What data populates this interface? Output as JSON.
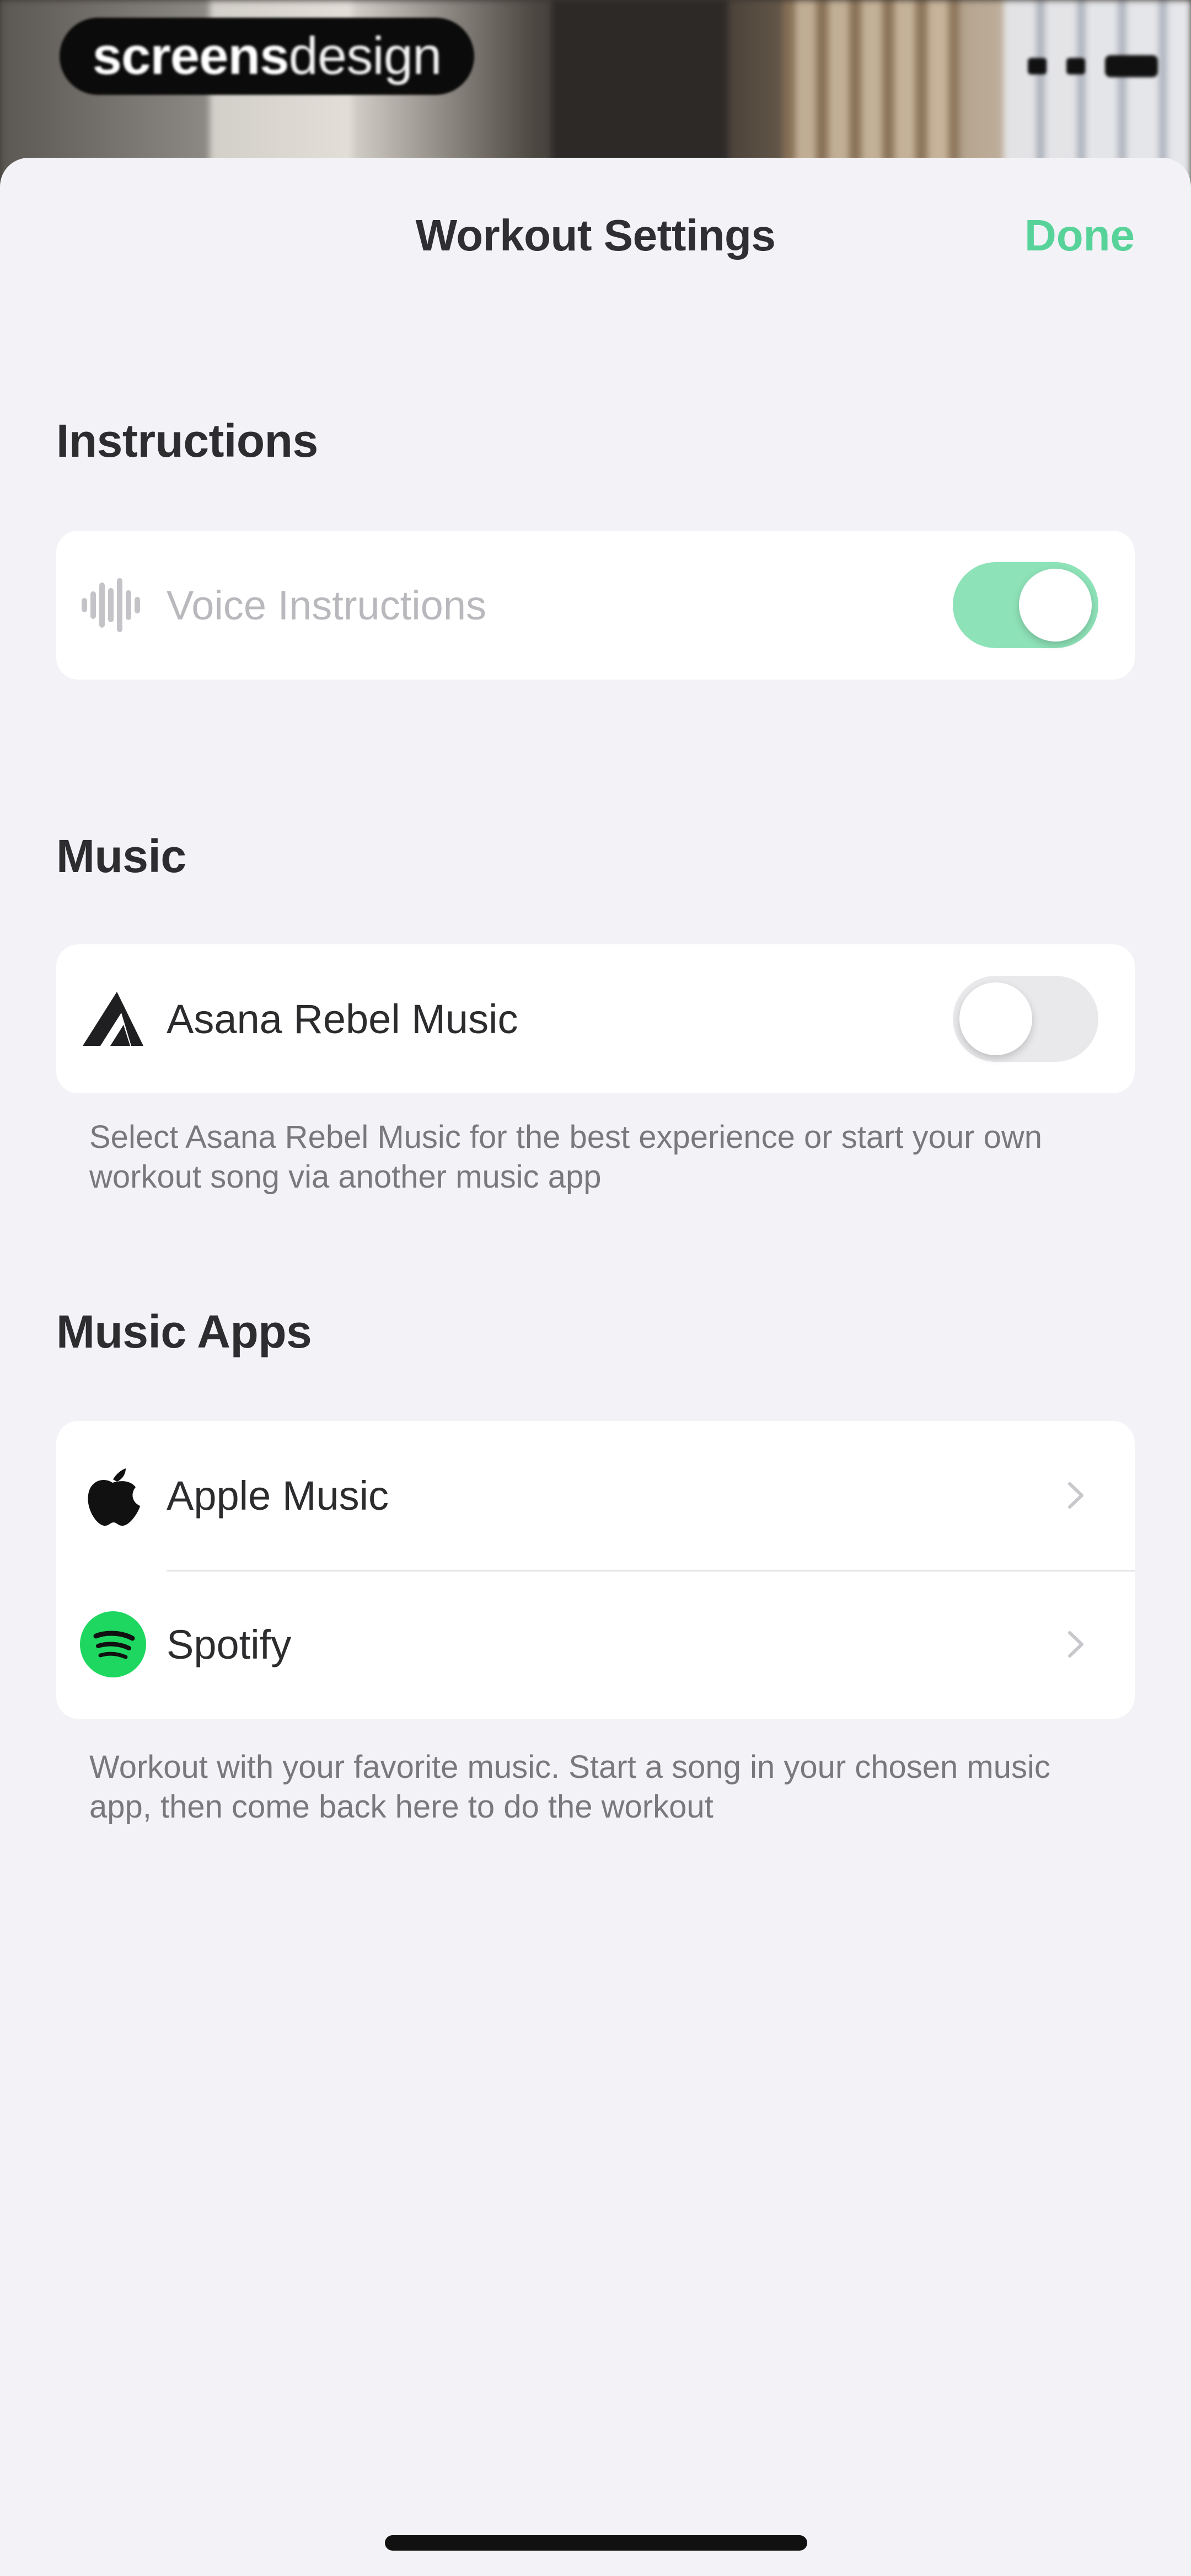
{
  "watermark": {
    "bold": "screens",
    "light": "design"
  },
  "nav": {
    "title": "Workout Settings",
    "done_label": "Done"
  },
  "instructions": {
    "header": "Instructions",
    "rows": [
      {
        "label": "Voice Instructions",
        "icon": "sound-wave-icon",
        "toggle_on": true
      }
    ]
  },
  "music": {
    "header": "Music",
    "rows": [
      {
        "label": "Asana Rebel Music",
        "icon": "asana-rebel-logo-icon",
        "toggle_on": false
      }
    ],
    "footnote": "Select Asana Rebel Music for the best experience or start your own workout song via another music app"
  },
  "music_apps": {
    "header": "Music Apps",
    "rows": [
      {
        "label": "Apple Music",
        "icon": "apple-icon"
      },
      {
        "label": "Spotify",
        "icon": "spotify-icon"
      }
    ],
    "footnote": "Workout with your favorite music. Start a song in your chosen music app, then come back here to do the workout"
  },
  "colors": {
    "accent": "#57d39a",
    "toggle_on": "#8ee2b8",
    "sheet_background": "#f2f2f7"
  }
}
